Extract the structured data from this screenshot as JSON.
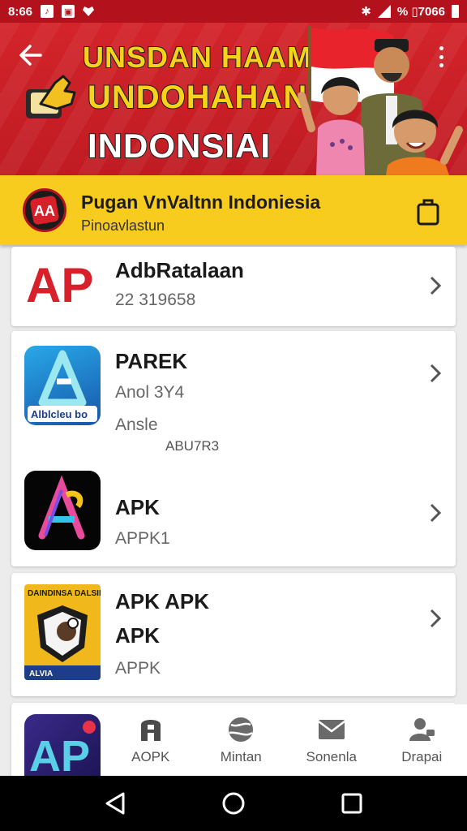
{
  "status_bar": {
    "time": "8:66",
    "right_text": "% ▯7066"
  },
  "banner": {
    "title_line_1": "UNSDAN HAAM",
    "title_line_2": "UNDOHAHAN",
    "title_line_3": "INDONSIAI",
    "back_icon": "arrow-left-icon",
    "menu_icon": "more-vertical-icon"
  },
  "app_bar": {
    "name": "Pugan VnValtnn Indoniesia",
    "subtitle": "Pinoavlastun",
    "logo_text": "AA"
  },
  "cards": [
    {
      "name": "AdbRatalaan",
      "meta": "22 319658",
      "logo_text": "AP"
    },
    {
      "name": "PAREK",
      "meta": "Anol 3Y4",
      "meta2": "Ansle",
      "meta3": "ABU7R3",
      "thumb_label": "Alblcleu bo"
    },
    {
      "name": "APK",
      "meta": "APPK1"
    },
    {
      "name_line_1": "APK APK",
      "name_line_2": "APK",
      "meta": "APPK",
      "thumb_text_top": "DAINDINSA DALSIDNSA",
      "thumb_text_bottom": "ALVIA"
    },
    {
      "logo_text": "AP"
    }
  ],
  "tabs": [
    {
      "label": "AOPK",
      "icon": "apk-logo-icon"
    },
    {
      "label": "Mintan",
      "icon": "globe-icon"
    },
    {
      "label": "Sonenla",
      "icon": "mail-icon"
    },
    {
      "label": "Drapai",
      "icon": "user-icon"
    }
  ],
  "colors": {
    "brand_red": "#c01b23",
    "brand_yellow": "#f8cc1e",
    "title_yellow": "#f7d21a"
  }
}
